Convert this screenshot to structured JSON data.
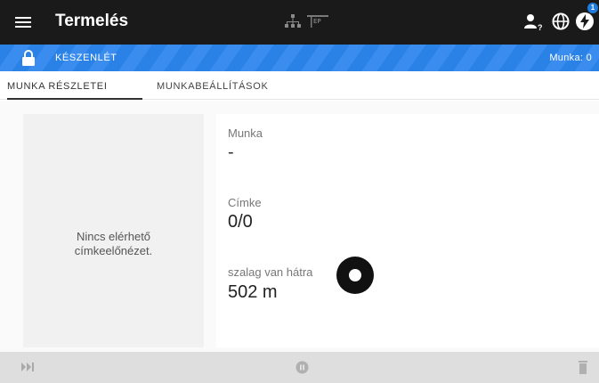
{
  "header": {
    "title": "Termelés",
    "printer_badge": "EP",
    "notification_count": "1",
    "icons": [
      "menu-icon",
      "network-icon",
      "printer-icon",
      "user-icon",
      "globe-icon",
      "power-icon"
    ]
  },
  "status": {
    "state": "KÉSZENLÉT",
    "job_counter": "Munka: 0",
    "accent": "#2a82e6",
    "icons": [
      "lock-icon"
    ]
  },
  "tabs": [
    {
      "label": "MUNKA RÉSZLETEI",
      "active": true
    },
    {
      "label": "MUNKABEÁLLÍTÁSOK",
      "active": false
    }
  ],
  "preview": {
    "message": "Nincs elérhető\ncímkeelőnézet."
  },
  "details": {
    "job_label": "Munka",
    "job_value": "-",
    "label_label": "Címke",
    "label_value": "0/0",
    "ribbon_label": "szalag van hátra",
    "ribbon_value": "502 m"
  },
  "bottom_bar": {
    "icons": [
      "play-step-icon",
      "pause-icon",
      "trash-icon"
    ]
  }
}
